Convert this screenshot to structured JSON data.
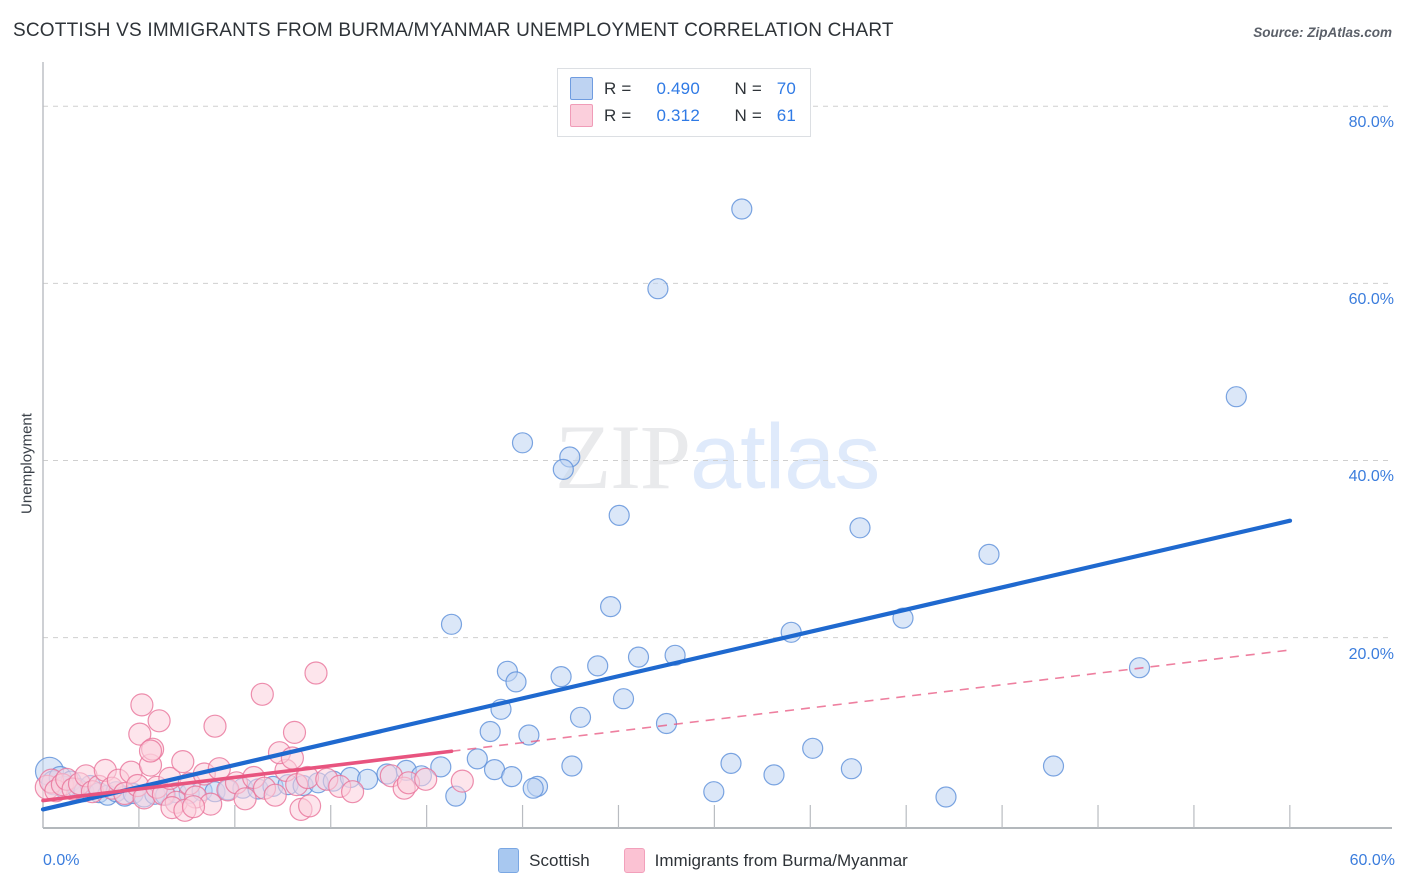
{
  "header": {
    "title": "SCOTTISH VS IMMIGRANTS FROM BURMA/MYANMAR UNEMPLOYMENT CORRELATION CHART",
    "source": "Source: ZipAtlas.com"
  },
  "watermark": {
    "primary": "ZIP",
    "secondary": "atlas"
  },
  "stat_legend": {
    "rows": [
      {
        "color": "#bed3f2",
        "r_label": "R =",
        "r_value": "0.490",
        "n_label": "N =",
        "n_value": "70"
      },
      {
        "color": "#fbcfdc",
        "r_label": "R =",
        "r_value": "0.312",
        "n_label": "N =",
        "n_value": "61"
      }
    ]
  },
  "series_legend": [
    {
      "label": "Scottish",
      "color": "#a8c8f0"
    },
    {
      "label": "Immigrants from Burma/Myanmar",
      "color": "#fbc2d3"
    }
  ],
  "axes": {
    "y_title": "Unemployment",
    "y_ticks": [
      "80.0%",
      "60.0%",
      "40.0%",
      "20.0%"
    ],
    "x_min_label": "0.0%",
    "x_max_label": "60.0%"
  },
  "chart_data": {
    "type": "scatter",
    "title": "SCOTTISH VS IMMIGRANTS FROM BURMA/MYANMAR UNEMPLOYMENT CORRELATION CHART",
    "xlabel": "",
    "ylabel": "Unemployment",
    "xlim": [
      0,
      60
    ],
    "ylim": [
      -1.5,
      85
    ],
    "x_ticks": [
      0,
      60
    ],
    "y_ticks": [
      20,
      40,
      60,
      80
    ],
    "grid": "horizontal-dashed",
    "legend_position": "bottom-center",
    "annotations": {
      "scottish_r": 0.49,
      "scottish_n": 70,
      "burma_r": 0.312,
      "burma_n": 61
    },
    "series": [
      {
        "name": "Scottish",
        "color": "#bed3f2",
        "edge_color": "#5b8fd9",
        "r": 0.49,
        "n": 70,
        "trendline": {
          "style": "solid",
          "color": "#1f69cf",
          "x0": 0.0,
          "y0": 0.6,
          "x1": 58.0,
          "y1": 33.2
        },
        "points": [
          {
            "x": 0.3,
            "y": 4.9,
            "r": 14
          },
          {
            "x": 0.5,
            "y": 3.6,
            "r": 12
          },
          {
            "x": 0.8,
            "y": 4.2,
            "r": 11
          },
          {
            "x": 1.0,
            "y": 3.1,
            "r": 11
          },
          {
            "x": 1.3,
            "y": 3.8,
            "r": 10
          },
          {
            "x": 1.6,
            "y": 3.0,
            "r": 10
          },
          {
            "x": 1.9,
            "y": 2.6,
            "r": 10
          },
          {
            "x": 2.2,
            "y": 3.3,
            "r": 10
          },
          {
            "x": 2.6,
            "y": 2.5,
            "r": 10
          },
          {
            "x": 3.0,
            "y": 2.2,
            "r": 10
          },
          {
            "x": 3.4,
            "y": 2.6,
            "r": 10
          },
          {
            "x": 3.8,
            "y": 2.1,
            "r": 10
          },
          {
            "x": 4.2,
            "y": 2.4,
            "r": 10
          },
          {
            "x": 4.7,
            "y": 2.0,
            "r": 10
          },
          {
            "x": 5.2,
            "y": 2.3,
            "r": 10
          },
          {
            "x": 5.7,
            "y": 2.2,
            "r": 10
          },
          {
            "x": 6.2,
            "y": 2.5,
            "r": 10
          },
          {
            "x": 6.8,
            "y": 2.4,
            "r": 10
          },
          {
            "x": 7.4,
            "y": 2.7,
            "r": 10
          },
          {
            "x": 8.0,
            "y": 2.6,
            "r": 10
          },
          {
            "x": 8.6,
            "y": 2.8,
            "r": 10
          },
          {
            "x": 9.3,
            "y": 3.0,
            "r": 10
          },
          {
            "x": 10.0,
            "y": 2.9,
            "r": 10
          },
          {
            "x": 10.7,
            "y": 3.2,
            "r": 10
          },
          {
            "x": 11.4,
            "y": 3.4,
            "r": 10
          },
          {
            "x": 12.1,
            "y": 3.3,
            "r": 10
          },
          {
            "x": 12.8,
            "y": 3.6,
            "r": 10
          },
          {
            "x": 13.5,
            "y": 3.8,
            "r": 10
          },
          {
            "x": 14.3,
            "y": 4.2,
            "r": 10
          },
          {
            "x": 15.1,
            "y": 4.0,
            "r": 10
          },
          {
            "x": 16.0,
            "y": 4.6,
            "r": 10
          },
          {
            "x": 16.9,
            "y": 5.0,
            "r": 10
          },
          {
            "x": 17.6,
            "y": 4.4,
            "r": 10
          },
          {
            "x": 18.5,
            "y": 5.4,
            "r": 10
          },
          {
            "x": 19.2,
            "y": 2.1,
            "r": 10
          },
          {
            "x": 20.2,
            "y": 6.3,
            "r": 10
          },
          {
            "x": 21.0,
            "y": 5.1,
            "r": 10
          },
          {
            "x": 21.8,
            "y": 4.3,
            "r": 10
          },
          {
            "x": 23.0,
            "y": 3.2,
            "r": 10
          },
          {
            "x": 19.0,
            "y": 21.5,
            "r": 10
          },
          {
            "x": 20.8,
            "y": 9.4,
            "r": 10
          },
          {
            "x": 22.3,
            "y": 42.0,
            "r": 10
          },
          {
            "x": 21.6,
            "y": 16.2,
            "r": 10
          },
          {
            "x": 22.0,
            "y": 15.0,
            "r": 10
          },
          {
            "x": 21.3,
            "y": 11.9,
            "r": 10
          },
          {
            "x": 22.6,
            "y": 9.0,
            "r": 10
          },
          {
            "x": 24.5,
            "y": 40.4,
            "r": 10
          },
          {
            "x": 24.2,
            "y": 39.0,
            "r": 10
          },
          {
            "x": 24.1,
            "y": 15.6,
            "r": 10
          },
          {
            "x": 22.8,
            "y": 3.0,
            "r": 10
          },
          {
            "x": 24.6,
            "y": 5.5,
            "r": 10
          },
          {
            "x": 26.8,
            "y": 33.8,
            "r": 10
          },
          {
            "x": 26.4,
            "y": 23.5,
            "r": 10
          },
          {
            "x": 25.8,
            "y": 16.8,
            "r": 10
          },
          {
            "x": 25.0,
            "y": 11.0,
            "r": 10
          },
          {
            "x": 27.7,
            "y": 17.8,
            "r": 10
          },
          {
            "x": 27.0,
            "y": 13.1,
            "r": 10
          },
          {
            "x": 28.6,
            "y": 59.4,
            "r": 10
          },
          {
            "x": 29.4,
            "y": 18.0,
            "r": 10
          },
          {
            "x": 29.0,
            "y": 10.3,
            "r": 10
          },
          {
            "x": 32.5,
            "y": 68.4,
            "r": 10
          },
          {
            "x": 31.2,
            "y": 2.6,
            "r": 10
          },
          {
            "x": 32.0,
            "y": 5.8,
            "r": 10
          },
          {
            "x": 34.0,
            "y": 4.5,
            "r": 10
          },
          {
            "x": 34.8,
            "y": 20.6,
            "r": 10
          },
          {
            "x": 35.8,
            "y": 7.5,
            "r": 10
          },
          {
            "x": 37.6,
            "y": 5.2,
            "r": 10
          },
          {
            "x": 38.0,
            "y": 32.4,
            "r": 10
          },
          {
            "x": 40.0,
            "y": 22.2,
            "r": 10
          },
          {
            "x": 42.0,
            "y": 2.0,
            "r": 10
          },
          {
            "x": 44.0,
            "y": 29.4,
            "r": 10
          },
          {
            "x": 47.0,
            "y": 5.5,
            "r": 10
          },
          {
            "x": 51.0,
            "y": 16.6,
            "r": 10
          },
          {
            "x": 55.5,
            "y": 47.2,
            "r": 10
          }
        ]
      },
      {
        "name": "Immigrants from Burma/Myanmar",
        "color": "#fbcfdc",
        "edge_color": "#e8739a",
        "r": 0.312,
        "n": 61,
        "trendline": {
          "style": "solid-then-dashed",
          "color": "#e8547f",
          "x0": 0.0,
          "y0": 1.6,
          "x1": 58.0,
          "y1": 18.6,
          "dash_start_x": 19.0
        },
        "points": [
          {
            "x": 0.2,
            "y": 3.1,
            "r": 12
          },
          {
            "x": 0.4,
            "y": 3.8,
            "r": 12
          },
          {
            "x": 0.6,
            "y": 2.7,
            "r": 11
          },
          {
            "x": 0.9,
            "y": 3.4,
            "r": 11
          },
          {
            "x": 1.1,
            "y": 4.0,
            "r": 11
          },
          {
            "x": 1.4,
            "y": 2.9,
            "r": 11
          },
          {
            "x": 1.7,
            "y": 3.5,
            "r": 11
          },
          {
            "x": 2.0,
            "y": 4.4,
            "r": 11
          },
          {
            "x": 2.3,
            "y": 2.6,
            "r": 11
          },
          {
            "x": 2.6,
            "y": 3.2,
            "r": 11
          },
          {
            "x": 2.9,
            "y": 5.0,
            "r": 11
          },
          {
            "x": 3.2,
            "y": 3.0,
            "r": 11
          },
          {
            "x": 3.5,
            "y": 3.9,
            "r": 11
          },
          {
            "x": 3.8,
            "y": 2.4,
            "r": 11
          },
          {
            "x": 4.1,
            "y": 4.8,
            "r": 11
          },
          {
            "x": 4.4,
            "y": 3.3,
            "r": 11
          },
          {
            "x": 4.7,
            "y": 1.9,
            "r": 11
          },
          {
            "x": 5.0,
            "y": 5.6,
            "r": 11
          },
          {
            "x": 5.3,
            "y": 3.1,
            "r": 11
          },
          {
            "x": 5.6,
            "y": 2.3,
            "r": 11
          },
          {
            "x": 5.9,
            "y": 4.1,
            "r": 11
          },
          {
            "x": 6.2,
            "y": 1.4,
            "r": 11
          },
          {
            "x": 6.5,
            "y": 6.0,
            "r": 11
          },
          {
            "x": 6.8,
            "y": 3.5,
            "r": 11
          },
          {
            "x": 7.1,
            "y": 2.0,
            "r": 11
          },
          {
            "x": 7.5,
            "y": 4.6,
            "r": 11
          },
          {
            "x": 7.8,
            "y": 1.2,
            "r": 11
          },
          {
            "x": 8.2,
            "y": 5.2,
            "r": 11
          },
          {
            "x": 8.6,
            "y": 2.8,
            "r": 11
          },
          {
            "x": 9.0,
            "y": 3.6,
            "r": 11
          },
          {
            "x": 4.5,
            "y": 9.1,
            "r": 11
          },
          {
            "x": 4.6,
            "y": 12.4,
            "r": 11
          },
          {
            "x": 5.1,
            "y": 7.4,
            "r": 11
          },
          {
            "x": 5.0,
            "y": 7.2,
            "r": 11
          },
          {
            "x": 5.4,
            "y": 10.6,
            "r": 11
          },
          {
            "x": 6.0,
            "y": 0.8,
            "r": 11
          },
          {
            "x": 6.6,
            "y": 0.5,
            "r": 11
          },
          {
            "x": 7.0,
            "y": 0.9,
            "r": 11
          },
          {
            "x": 9.4,
            "y": 1.8,
            "r": 11
          },
          {
            "x": 9.8,
            "y": 4.2,
            "r": 11
          },
          {
            "x": 10.3,
            "y": 3.0,
            "r": 11
          },
          {
            "x": 10.8,
            "y": 2.2,
            "r": 11
          },
          {
            "x": 11.3,
            "y": 5.0,
            "r": 11
          },
          {
            "x": 11.8,
            "y": 3.4,
            "r": 11
          },
          {
            "x": 12.3,
            "y": 4.2,
            "r": 11
          },
          {
            "x": 11.0,
            "y": 7.0,
            "r": 11
          },
          {
            "x": 11.6,
            "y": 6.4,
            "r": 11
          },
          {
            "x": 12.0,
            "y": 0.6,
            "r": 11
          },
          {
            "x": 12.4,
            "y": 1.0,
            "r": 11
          },
          {
            "x": 13.2,
            "y": 4.0,
            "r": 11
          },
          {
            "x": 13.8,
            "y": 3.2,
            "r": 11
          },
          {
            "x": 14.4,
            "y": 2.6,
            "r": 11
          },
          {
            "x": 10.2,
            "y": 13.6,
            "r": 11
          },
          {
            "x": 11.7,
            "y": 9.3,
            "r": 11
          },
          {
            "x": 12.7,
            "y": 16.0,
            "r": 11
          },
          {
            "x": 8.0,
            "y": 10.0,
            "r": 11
          },
          {
            "x": 16.2,
            "y": 4.4,
            "r": 11
          },
          {
            "x": 16.8,
            "y": 3.0,
            "r": 11
          },
          {
            "x": 17.0,
            "y": 3.6,
            "r": 11
          },
          {
            "x": 17.8,
            "y": 4.0,
            "r": 11
          },
          {
            "x": 19.5,
            "y": 3.8,
            "r": 11
          }
        ]
      }
    ]
  }
}
